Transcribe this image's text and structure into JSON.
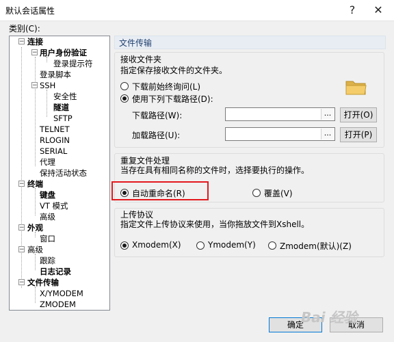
{
  "window": {
    "title": "默认会话属性",
    "help_label": "?",
    "close_label": "✕"
  },
  "category_label": "类别(C):",
  "tree": {
    "connection": "连接",
    "user_auth": "用户身份验证",
    "login_prompt": "登录提示符",
    "login_script": "登录脚本",
    "ssh": "SSH",
    "security": "安全性",
    "tunnel": "隧道",
    "sftp": "SFTP",
    "telnet": "TELNET",
    "rlogin": "RLOGIN",
    "serial": "SERIAL",
    "proxy": "代理",
    "keepalive": "保持活动状态",
    "terminal": "终端",
    "keyboard": "键盘",
    "vt_mode": "VT 模式",
    "advanced1": "高级",
    "appearance": "外观",
    "window": "窗口",
    "advanced2": "高级",
    "trace": "跟踪",
    "logging": "日志记录",
    "file_transfer": "文件传输",
    "xymodem": "X/YMODEM",
    "zmodem": "ZMODEM"
  },
  "panel": {
    "header": "文件传输",
    "receive": {
      "title": "接收文件夹",
      "desc": "指定保存接收文件的文件夹。",
      "ask_label": "下载前始终询问(L)",
      "use_label": "使用下列下载路径(D):",
      "download_path_label": "下载路径(W):",
      "download_path_value": "",
      "upload_path_label": "加载路径(U):",
      "upload_path_value": "",
      "browse": "...",
      "open_o": "打开(O)",
      "open_p": "打开(P)"
    },
    "duplicate": {
      "title": "重复文件处理",
      "desc": "当存在具有相同名称的文件时，选择要执行的操作。",
      "auto_rename": "自动重命名(R)",
      "overwrite": "覆盖(V)"
    },
    "upload": {
      "title": "上传协议",
      "desc": "指定文件上传协议来使用，当你拖放文件到Xshell。",
      "xmodem": "Xmodem(X)",
      "ymodem": "Ymodem(Y)",
      "zmodem": "Zmodem(默认)(Z)"
    }
  },
  "buttons": {
    "ok": "确定",
    "cancel": "取消"
  },
  "watermark": "Bai 经验",
  "colors": {
    "highlight_box": "#e3171c",
    "focus_border": "#0078d7",
    "header_bg": "#e8edf4"
  }
}
